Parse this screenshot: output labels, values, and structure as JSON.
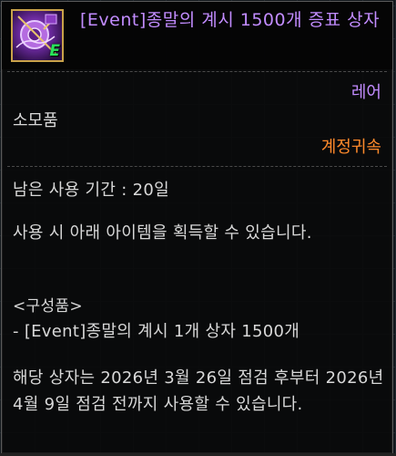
{
  "item": {
    "name": "[Event]종말의 계시 1500개 증표 상자",
    "icon": "purple-orb-box-icon",
    "badge": "E",
    "rarity": "레어",
    "category": "소모품",
    "binding": "계정귀속",
    "period": "남은 사용 기간 : 20일",
    "usage": "사용 시 아래 아이템을 획득할 수 있습니다.",
    "contents_label": "<구성품>",
    "contents": [
      "- [Event]종말의 계시 1개 상자 1500개"
    ],
    "notice": "해당 상자는 2026년 3월 26일 점검 후부터 2026년 4월 9일 점검 전까지 사용할 수 있습니다."
  },
  "colors": {
    "name": "#c28cff",
    "rarity": "#c28cff",
    "binding": "#ff8a2b",
    "text": "#d8d8d8",
    "badge": "#29e35a",
    "icon_border": "#c9a24a"
  }
}
